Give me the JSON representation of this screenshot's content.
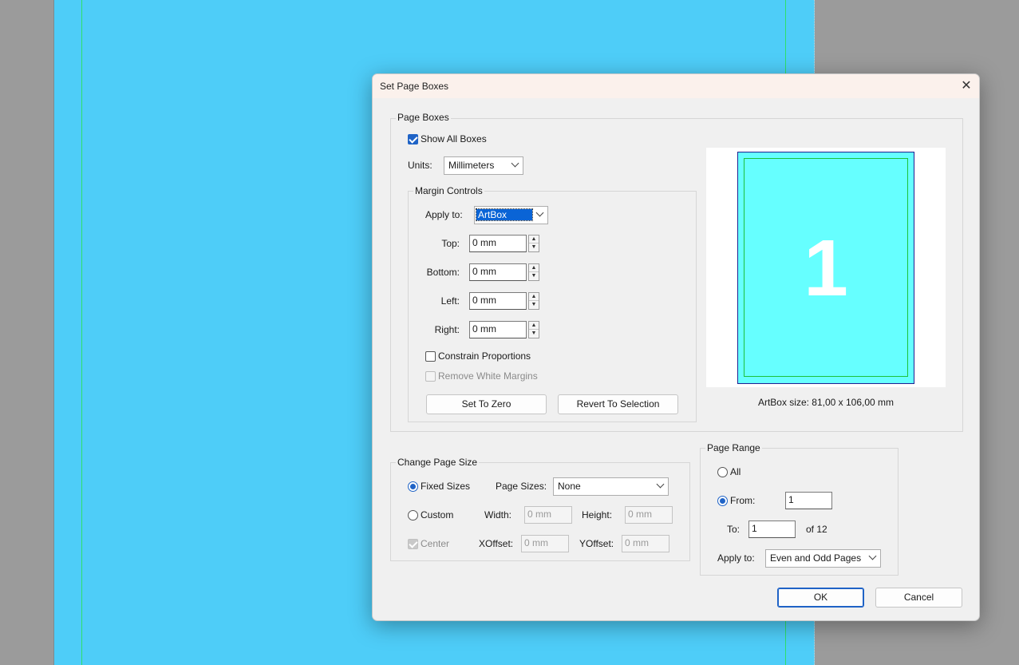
{
  "dialog": {
    "title": "Set Page Boxes",
    "close_icon": "close-icon"
  },
  "page_boxes": {
    "title": "Page Boxes",
    "show_all_boxes": {
      "label": "Show All Boxes",
      "checked": true
    },
    "units": {
      "label": "Units:",
      "value": "Millimeters"
    },
    "margin_controls": {
      "title": "Margin Controls",
      "apply_to": {
        "label": "Apply to:",
        "value": "ArtBox"
      },
      "top": {
        "label": "Top:",
        "value": "0 mm"
      },
      "bottom": {
        "label": "Bottom:",
        "value": "0 mm"
      },
      "left": {
        "label": "Left:",
        "value": "0 mm"
      },
      "right": {
        "label": "Right:",
        "value": "0 mm"
      },
      "constrain_proportions": {
        "label": "Constrain Proportions",
        "checked": false
      },
      "remove_white_margins": {
        "label": "Remove White Margins",
        "checked": false,
        "enabled": false
      },
      "set_to_zero": "Set To Zero",
      "revert_to_selection": "Revert To Selection"
    },
    "preview": {
      "page_number": "1",
      "caption": "ArtBox size: 81,00 x 106,00 mm"
    }
  },
  "change_page_size": {
    "title": "Change Page Size",
    "fixed_sizes": {
      "label": "Fixed Sizes",
      "selected": true
    },
    "page_sizes": {
      "label": "Page Sizes:",
      "value": "None"
    },
    "custom": {
      "label": "Custom",
      "selected": false
    },
    "width": {
      "label": "Width:",
      "value": "0 mm"
    },
    "height": {
      "label": "Height:",
      "value": "0 mm"
    },
    "center": {
      "label": "Center",
      "checked": true,
      "enabled": false
    },
    "xoffset": {
      "label": "XOffset:",
      "value": "0 mm"
    },
    "yoffset": {
      "label": "YOffset:",
      "value": "0 mm"
    }
  },
  "page_range": {
    "title": "Page Range",
    "all": {
      "label": "All",
      "selected": false
    },
    "from": {
      "label": "From:",
      "value": "1",
      "selected": true
    },
    "to": {
      "label": "To:",
      "value": "1"
    },
    "of_total": "of 12",
    "apply_to": {
      "label": "Apply to:",
      "value": "Even and Odd Pages"
    }
  },
  "buttons": {
    "ok": "OK",
    "cancel": "Cancel"
  },
  "colors": {
    "background_page": "#4ecdf8",
    "guide": "#2ee06a",
    "accent": "#1f63c6",
    "preview_page": "#66ffff"
  }
}
